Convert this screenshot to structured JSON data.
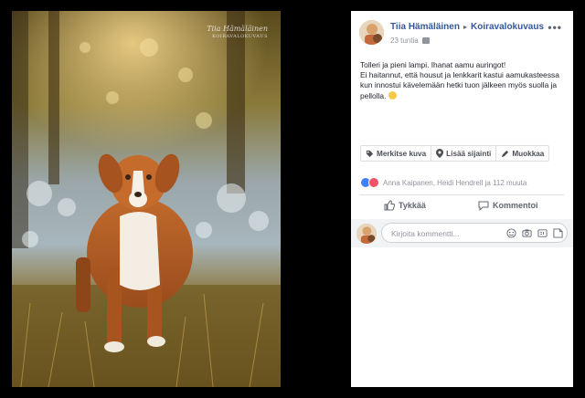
{
  "photo": {
    "watermark_line1": "Tiia Hämäläinen",
    "watermark_line2": "KOIRAVALOKUVAUS"
  },
  "post": {
    "author": "Tiia Hämäläinen",
    "separator": "▸",
    "page": "Koiravalokuvaus",
    "time": "23 tuntia",
    "text_line1": "Tolleri ja pieni lampi. Ihanat aamu auringot!",
    "text_line2": "Ei haitannut, että housut ja lenkkarit kastui aamukasteessa kun innostui kävelemään hetki tuon jälkeen myös suolla ja pellolla.",
    "more_label": "•••"
  },
  "tag_bar": {
    "tag_photo": "Merkitse kuva",
    "add_location": "Lisää sijainti",
    "edit": "Muokkaa"
  },
  "reactions": {
    "text": "Anna Kaipanen, Heidi Hendrell ja 112 muuta"
  },
  "actions": {
    "like": "Tykkää",
    "comment": "Kommentoi"
  },
  "comment_box": {
    "placeholder": "Kirjoita kommentti..."
  },
  "colors": {
    "link_blue": "#365899",
    "like_blue": "#4080ff",
    "love_red": "#f25268"
  },
  "icons": [
    "more-icon",
    "globe-icon",
    "tag-icon",
    "location-icon",
    "pencil-icon",
    "like-icon",
    "comment-icon",
    "emoji-icon",
    "camera-icon",
    "gif-icon",
    "sticker-icon"
  ]
}
